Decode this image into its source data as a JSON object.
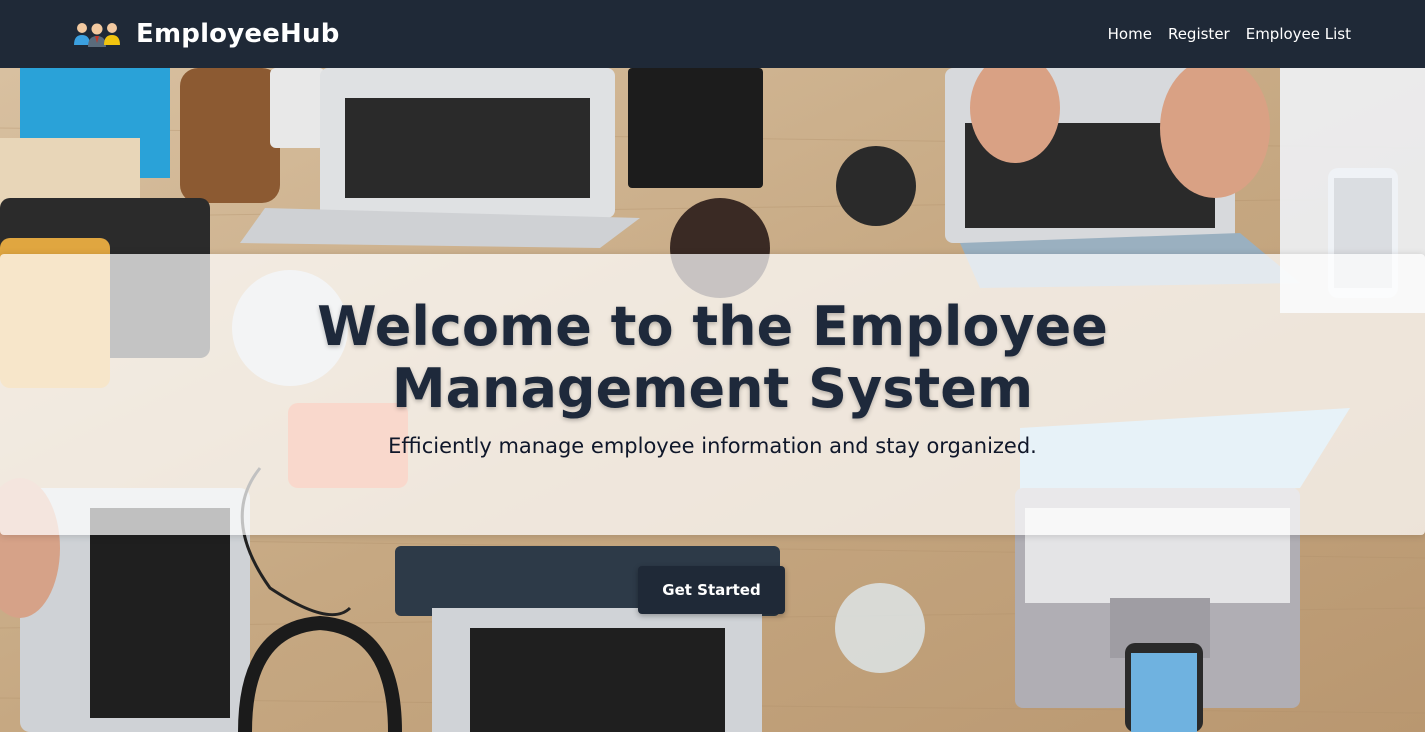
{
  "navbar": {
    "brand_name": "EmployeeHub",
    "logo_icon": "team-people-icon",
    "links": [
      {
        "label": "Home"
      },
      {
        "label": "Register"
      },
      {
        "label": "Employee List"
      }
    ]
  },
  "hero": {
    "title": "Welcome to the Employee Management System",
    "subtitle": "Efficiently manage employee information and stay organized.",
    "cta_label": "Get Started",
    "background_image": "office-desk-laptops-photo"
  },
  "colors": {
    "navbar_bg": "#1f2937",
    "title_text": "#1e293b",
    "button_bg": "#1f2937",
    "button_text": "#ffffff"
  }
}
